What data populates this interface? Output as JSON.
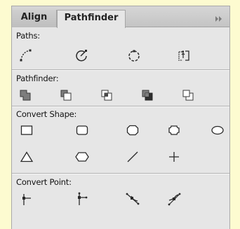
{
  "tabs": [
    {
      "label": "Align",
      "active": false
    },
    {
      "label": "Pathfinder",
      "active": true
    }
  ],
  "panel_menu_icon": "double-chevron-right-icon",
  "sections": {
    "paths": {
      "label": "Paths:",
      "buttons": [
        "open-path-icon",
        "close-path-icon",
        "reverse-path-icon",
        "split-path-icon"
      ]
    },
    "pathfinder": {
      "label": "Pathfinder:",
      "buttons": [
        "unite-icon",
        "minus-front-icon",
        "intersect-icon",
        "exclude-icon",
        "minus-back-icon"
      ]
    },
    "convert_shape": {
      "label": "Convert Shape:",
      "buttons": [
        "rectangle-icon",
        "rounded-rectangle-icon",
        "beveled-rectangle-icon",
        "inverse-rounded-rectangle-icon",
        "ellipse-icon",
        "triangle-icon",
        "polygon-icon",
        "line-icon",
        "orthogonal-line-icon"
      ]
    },
    "convert_point": {
      "label": "Convert Point:",
      "buttons": [
        "plain-point-icon",
        "corner-point-icon",
        "smooth-point-icon",
        "symmetrical-point-icon"
      ]
    }
  },
  "colors": {
    "page_bg": "#fdfbd0",
    "panel_bg": "#e6e6e6",
    "tab_bar": "#c8c8c8",
    "icon_dark": "#2a2a2a",
    "icon_gray": "#8c8c8c"
  }
}
